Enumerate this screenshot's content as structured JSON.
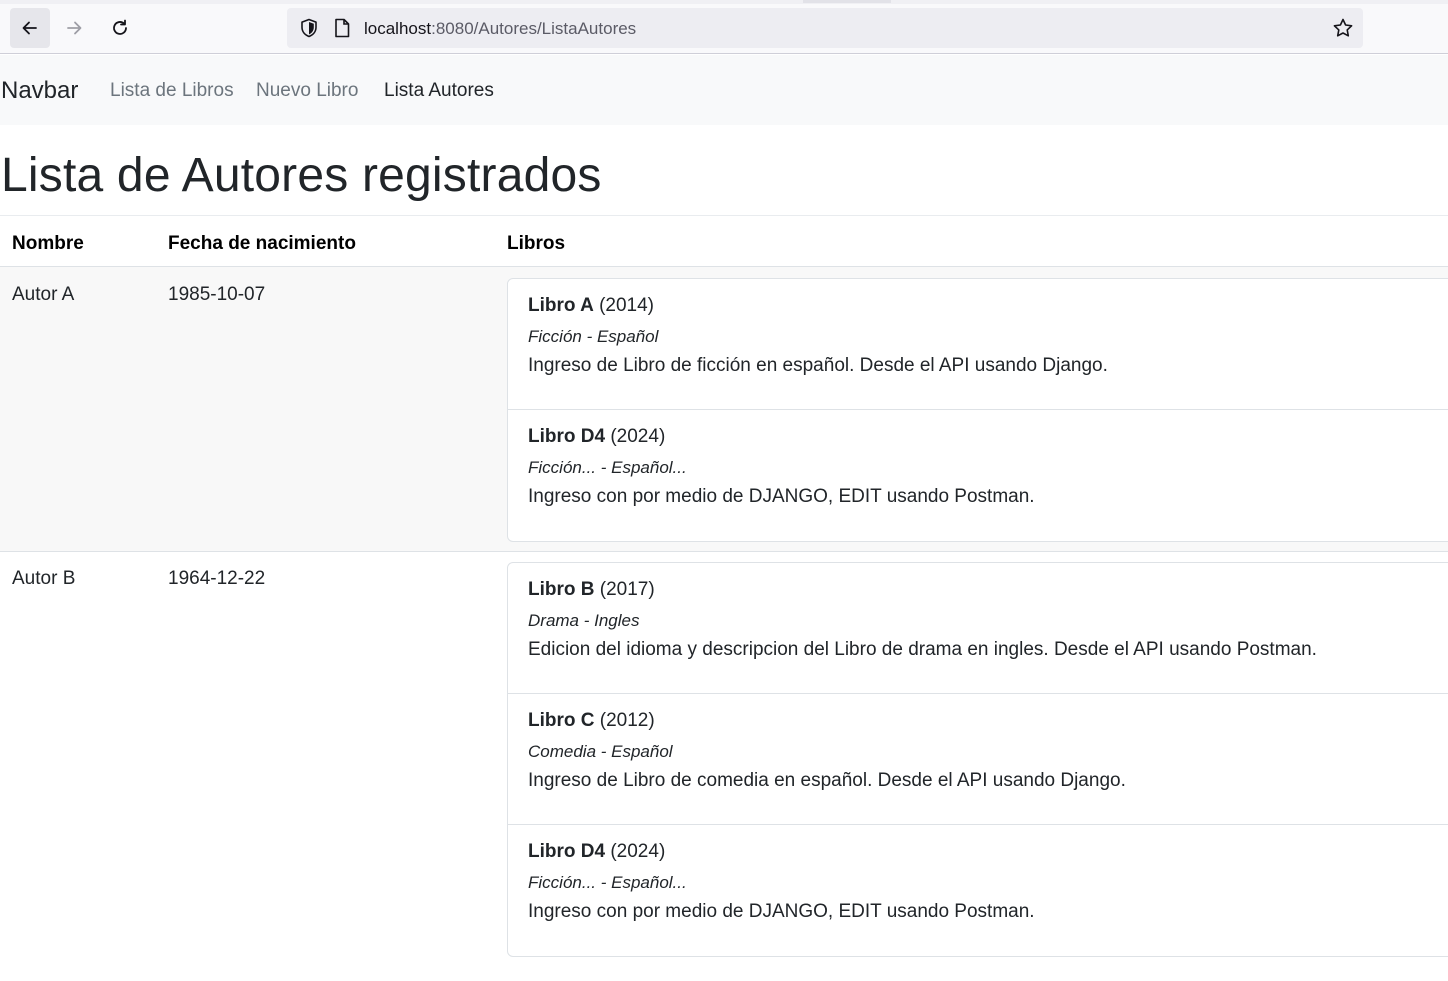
{
  "browser": {
    "url_host": "localhost",
    "url_rest": ":8080/Autores/ListaAutores"
  },
  "navbar": {
    "brand": "Navbar",
    "links": [
      {
        "label": "Lista de Libros",
        "active": false
      },
      {
        "label": "Nuevo Libro",
        "active": false
      },
      {
        "label": "Lista Autores",
        "active": true
      }
    ]
  },
  "page": {
    "title": "Lista de Autores registrados"
  },
  "table": {
    "headers": [
      "Nombre",
      "Fecha de nacimiento",
      "Libros"
    ],
    "rows": [
      {
        "nombre": "Autor A",
        "fecha": "1985-10-07",
        "libros": [
          {
            "titulo": "Libro A",
            "anio": "(2014)",
            "meta": "Ficción - Español",
            "descripcion": "Ingreso de Libro de ficción en español. Desde el API usando Django."
          },
          {
            "titulo": "Libro D4",
            "anio": "(2024)",
            "meta": "Ficción... - Español...",
            "descripcion": "Ingreso con por medio de DJANGO, EDIT usando Postman."
          }
        ]
      },
      {
        "nombre": "Autor B",
        "fecha": "1964-12-22",
        "libros": [
          {
            "titulo": "Libro B",
            "anio": "(2017)",
            "meta": "Drama - Ingles",
            "descripcion": "Edicion del idioma y descripcion del Libro de drama en ingles. Desde el API usando Postman."
          },
          {
            "titulo": "Libro C",
            "anio": "(2012)",
            "meta": "Comedia - Español",
            "descripcion": "Ingreso de Libro de comedia en español. Desde el API usando Django."
          },
          {
            "titulo": "Libro D4",
            "anio": "(2024)",
            "meta": "Ficción... - Español...",
            "descripcion": "Ingreso con por medio de DJANGO, EDIT usando Postman."
          }
        ]
      }
    ]
  }
}
